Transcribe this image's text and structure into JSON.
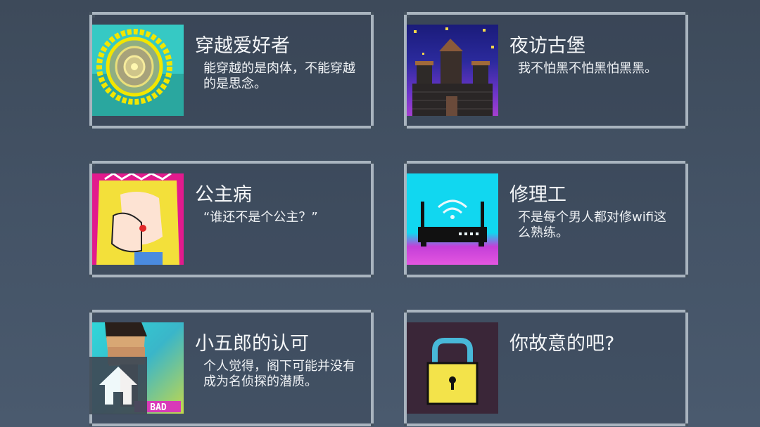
{
  "achievements": [
    {
      "title": "穿越爱好者",
      "desc": "能穿越的是肉体，不能穿越的是思念。",
      "icon": "portal-icon"
    },
    {
      "title": "夜访古堡",
      "desc": "我不怕黑不怕黑怕黑黑。",
      "icon": "castle-icon"
    },
    {
      "title": "公主病",
      "desc": "“谁还不是个公主？”",
      "icon": "princess-icon"
    },
    {
      "title": "修理工",
      "desc": "不是每个男人都对修wifi这么熟练。",
      "icon": "router-icon"
    },
    {
      "title": "小五郎的认可",
      "desc": "个人觉得，阁下可能并没有成为名侦探的潜质。",
      "icon": "detective-icon",
      "badge": "BAD"
    },
    {
      "title": "你故意的吧?",
      "desc": "",
      "icon": "lock-icon"
    }
  ],
  "colors": {
    "border": "#a9b4bf",
    "background": "#445366",
    "text": "#f4f6f8"
  }
}
